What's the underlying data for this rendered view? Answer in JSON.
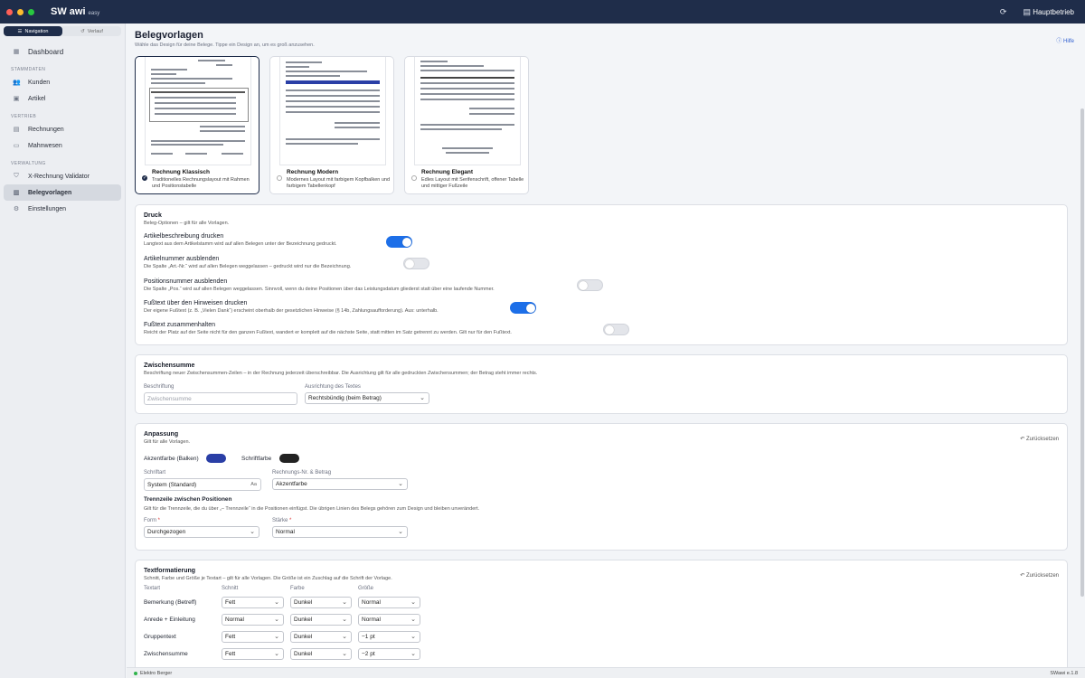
{
  "app": {
    "brand": "SW awi",
    "brand_sub": "easy",
    "company": "Hauptbetrieb"
  },
  "colors": {
    "titlebar": "#1f2d4a",
    "accent_toggle": "#1d6fe8",
    "akzent": "#2a3fa6",
    "schrift": "#222222"
  },
  "sidebar": {
    "segments": [
      {
        "label": "Navigation",
        "icon": "list-icon"
      },
      {
        "label": "Verlauf",
        "icon": "history-icon"
      }
    ],
    "dashboard": "Dashboard",
    "sections": [
      {
        "title": "STAMMDATEN",
        "items": [
          "Kunden",
          "Artikel"
        ]
      },
      {
        "title": "VERTRIEB",
        "items": [
          "Rechnungen",
          "Mahnwesen"
        ]
      },
      {
        "title": "VERWALTUNG",
        "items": [
          "X-Rechnung Validator",
          "Belegvorlagen",
          "Einstellungen"
        ]
      }
    ]
  },
  "page": {
    "title": "Belegvorlagen",
    "subtitle": "Wähle das Design für deine Belege. Tippe ein Design an, um es groß anzusehen.",
    "help": "Hilfe"
  },
  "templates": [
    {
      "name": "Rechnung Klassisch",
      "desc": "Traditionelles Rechnungslayout mit Rahmen und Positionstabelle",
      "selected": true
    },
    {
      "name": "Rechnung Modern",
      "desc": "Modernes Layout mit farbigem Kopfbalken und farbigem Tabellenkopf",
      "selected": false
    },
    {
      "name": "Rechnung Elegant",
      "desc": "Edles Layout mit Serifenschrift, offener Tabelle und mittiger Fußzeile",
      "selected": false
    }
  ],
  "druck": {
    "title": "Druck",
    "subtitle": "Beleg-Optionen – gilt für alle Vorlagen.",
    "options": [
      {
        "title": "Artikelbeschreibung drucken",
        "desc": "Langtext aus dem Artikelstamm wird auf allen Belegen unter der Bezeichnung gedruckt.",
        "on": true
      },
      {
        "title": "Artikelnummer ausblenden",
        "desc": "Die Spalte „Art.-Nr.“ wird auf allen Belegen weggelassen – gedruckt wird nur die Bezeichnung.",
        "on": false
      },
      {
        "title": "Positionsnummer ausblenden",
        "desc": "Die Spalte „Pos.“ wird auf allen Belegen weggelassen. Sinnvoll, wenn du deine Positionen über das Leistungsdatum gliederst statt über eine laufende Nummer.",
        "on": false
      },
      {
        "title": "Fußtext über den Hinweisen drucken",
        "desc": "Der eigene Fußtext (z. B. „Vielen Dank“) erscheint oberhalb der gesetzlichen Hinweise (§ 14b, Zahlungsaufforderung). Aus: unterhalb.",
        "on": true
      },
      {
        "title": "Fußtext zusammenhalten",
        "desc": "Reicht der Platz auf der Seite nicht für den ganzen Fußtext, wandert er komplett auf die nächste Seite, statt mitten im Satz getrennt zu werden. Gilt nur für den Fußtext.",
        "on": false
      }
    ]
  },
  "zwischensumme": {
    "title": "Zwischensumme",
    "subtitle": "Beschriftung neuer Zwischensummen-Zeilen – in der Rechnung jederzeit überschreibbar. Die Ausrichtung gilt für alle gedruckten Zwischensummen; der Betrag steht immer rechts.",
    "label_beschriftung": "Beschriftung",
    "placeholder": "Zwischensumme",
    "label_ausrichtung": "Ausrichtung des Textes",
    "ausrichtung": "Rechtsbündig (beim Betrag)"
  },
  "anpassung": {
    "title": "Anpassung",
    "subtitle": "Gilt für alle Vorlagen.",
    "reset": "Zurücksetzen",
    "akzent_label": "Akzentfarbe (Balken)",
    "schrift_label": "Schriftfarbe",
    "schriftart_label": "Schriftart",
    "schriftart": "System (Standard)",
    "schriftart_suffix": "Aa",
    "rnr_label": "Rechnungs-Nr. & Betrag",
    "rnr": "Akzentfarbe",
    "trenn_title": "Trennzeile zwischen Positionen",
    "trenn_desc": "Gilt für die Trennzeile, die du über „– Trennzeile“ in die Positionen einfügst. Die übrigen Linien des Belegs gehören zum Design und bleiben unverändert.",
    "form_label": "Form",
    "form": "Durchgezogen",
    "staerke_label": "Stärke",
    "staerke": "Normal"
  },
  "textformat": {
    "title": "Textformatierung",
    "subtitle": "Schnitt, Farbe und Größe je Textart – gilt für alle Vorlagen. Die Größe ist ein Zuschlag auf die Schrift der Vorlage.",
    "reset": "Zurücksetzen",
    "headers": [
      "Textart",
      "Schnitt",
      "Farbe",
      "Größe"
    ],
    "rows": [
      {
        "name": "Bemerkung (Betreff)",
        "schnitt": "Fett",
        "farbe": "Dunkel",
        "groesse": "Normal"
      },
      {
        "name": "Anrede + Einleitung",
        "schnitt": "Normal",
        "farbe": "Dunkel",
        "groesse": "Normal"
      },
      {
        "name": "Gruppentext",
        "schnitt": "Fett",
        "farbe": "Dunkel",
        "groesse": "−1 pt"
      },
      {
        "name": "Zwischensumme",
        "schnitt": "Fett",
        "farbe": "Dunkel",
        "groesse": "−2 pt"
      }
    ]
  },
  "status": {
    "company": "Elektro Berger",
    "version": "SWawi e.1.8"
  }
}
